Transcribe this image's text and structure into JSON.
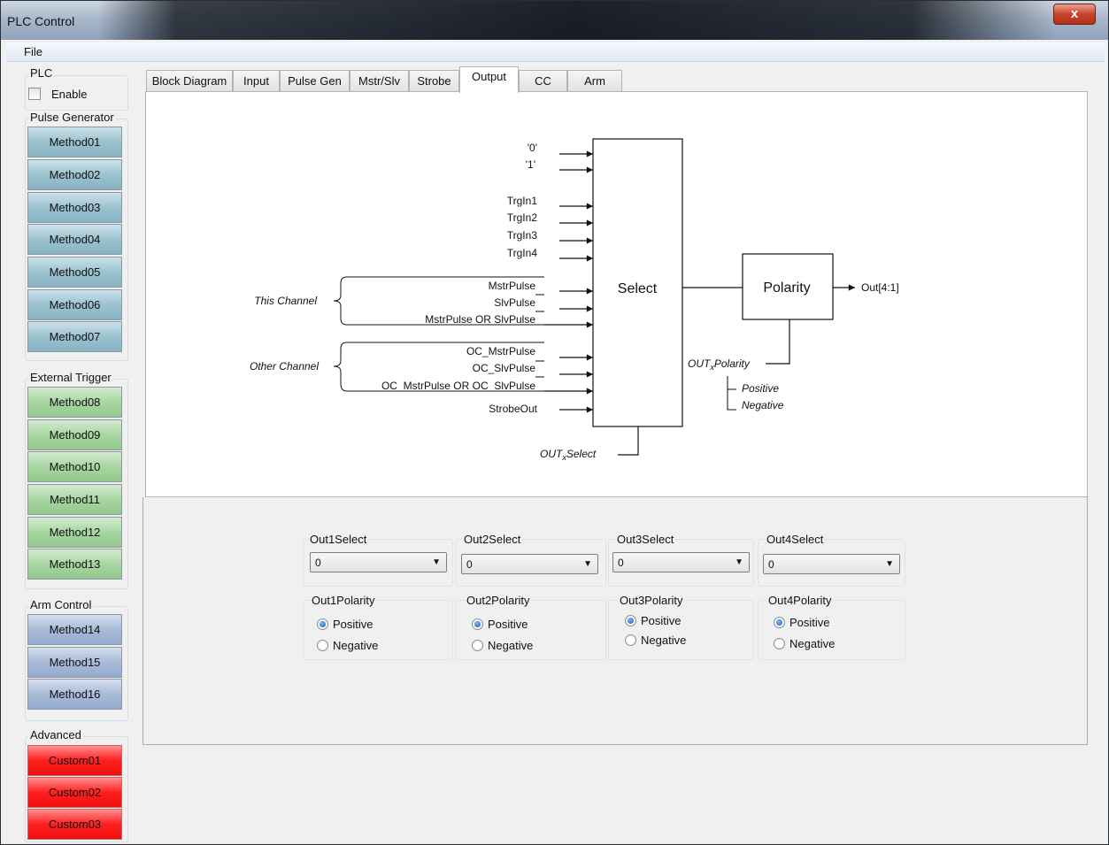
{
  "window": {
    "title": "PLC Control",
    "close_glyph": "x"
  },
  "menu": {
    "file": "File"
  },
  "sidebar": {
    "plc": {
      "label": "PLC",
      "enable_label": "Enable",
      "enable_checked": false
    },
    "pulse_generator": {
      "label": "Pulse Generator",
      "buttons": [
        "Method01",
        "Method02",
        "Method03",
        "Method04",
        "Method05",
        "Method06",
        "Method07"
      ]
    },
    "external_trigger": {
      "label": "External Trigger",
      "buttons": [
        "Method08",
        "Method09",
        "Method10",
        "Method11",
        "Method12",
        "Method13"
      ]
    },
    "arm_control": {
      "label": "Arm Control",
      "buttons": [
        "Method14",
        "Method15",
        "Method16"
      ]
    },
    "advanced": {
      "label": "Advanced",
      "buttons": [
        "Custom01",
        "Custom02",
        "Custom03"
      ]
    }
  },
  "tabs": [
    "Block Diagram",
    "Input",
    "Pulse Gen",
    "Mstr/Slv",
    "Strobe",
    "Output",
    "CC",
    "Arm"
  ],
  "active_tab": "Output",
  "diagram": {
    "inputs_top": [
      "'0'",
      "'1'"
    ],
    "trig_inputs": [
      "TrgIn1",
      "TrgIn2",
      "TrgIn3",
      "TrgIn4"
    ],
    "this_channel_label": "This Channel",
    "this_channel_inputs": [
      "MstrPulse",
      "SlvPulse",
      "MstrPulse OR SlvPulse"
    ],
    "other_channel_label": "Other Channel",
    "other_channel_inputs": [
      "OC_MstrPulse",
      "OC_SlvPulse",
      "OC_MstrPulse OR OC_SlvPulse"
    ],
    "strobe_input": "StrobeOut",
    "select_block": "Select",
    "polarity_block": "Polarity",
    "output": "Out[4:1]",
    "polarity_ctrl": {
      "prefix": "OUT",
      "subscript": "x",
      "suffix": "Polarity"
    },
    "polarity_options": [
      "Positive",
      "Negative"
    ],
    "select_ctrl": {
      "prefix": "OUT",
      "subscript": "x",
      "suffix": "Select"
    }
  },
  "outputs": [
    {
      "select_label": "Out1Select",
      "select_value": "0",
      "polarity_label": "Out1Polarity",
      "positive": "Positive",
      "negative": "Negative",
      "polarity": "Positive"
    },
    {
      "select_label": "Out2Select",
      "select_value": "0",
      "polarity_label": "Out2Polarity",
      "positive": "Positive",
      "negative": "Negative",
      "polarity": "Positive"
    },
    {
      "select_label": "Out3Select",
      "select_value": "0",
      "polarity_label": "Out3Polarity",
      "positive": "Positive",
      "negative": "Negative",
      "polarity": "Positive"
    },
    {
      "select_label": "Out4Select",
      "select_value": "0",
      "polarity_label": "Out4Polarity",
      "positive": "Positive",
      "negative": "Negative",
      "polarity": "Positive"
    }
  ],
  "colors": {
    "pulse_generator": "#9cc2cf",
    "external_trigger": "#a8d6a2",
    "arm_control": "#a8bbd7",
    "advanced": "#ff1f1f"
  }
}
